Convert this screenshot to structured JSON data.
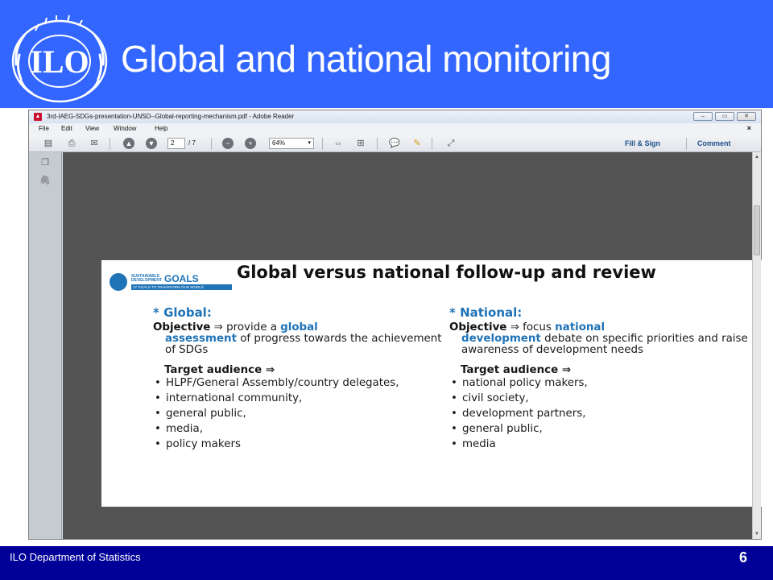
{
  "slide": {
    "title": "Global and national monitoring",
    "footer": "ILO Department of Statistics",
    "page_number": "6",
    "logo_text": "ILO"
  },
  "reader": {
    "window_title": "3rd-IAEG-SDGs-presentation-UNSD--Global-reporting-mechanism.pdf - Adobe Reader",
    "menu": [
      "File",
      "Edit",
      "View",
      "Window",
      "Help"
    ],
    "page_current": "2",
    "page_total": "/ 7",
    "zoom": "64%",
    "fill_sign": "Fill & Sign",
    "comment": "Comment"
  },
  "pdf": {
    "sdg_line1": "SUSTAINABLE",
    "sdg_line2": "DEVELOPMENT",
    "sdg_goals": "GOALS",
    "sdg_tagline": "17 GOALS TO TRANSFORM OUR WORLD",
    "heading": "Global versus national follow-up and review",
    "global": {
      "label": "* Global:",
      "objective_lead": "Objective",
      "arrow": "⇒",
      "obj_text1": " provide a ",
      "obj_hl1": "global",
      "obj_hl2": "assessment",
      "obj_text2": " of progress towards the achievement of SDGs",
      "target": "Target audience ⇒",
      "items": [
        "HLPF/General Assembly/country delegates,",
        "international community,",
        "general public,",
        "media,",
        "policy makers"
      ]
    },
    "national": {
      "label": "* National:",
      "objective_lead": "Objective",
      "arrow": "⇒",
      "obj_text1": " focus ",
      "obj_hl1": "national",
      "obj_hl2": "development",
      "obj_text2": " debate on specific priorities and raise awareness of development needs",
      "target": "Target audience ⇒",
      "items": [
        "national policy makers,",
        "civil society,",
        "development partners,",
        "general public,",
        "media"
      ]
    }
  },
  "colors": {
    "header_blue": "#3366ff",
    "footer_navy": "#000099",
    "un_blue": "#1f73b7"
  }
}
